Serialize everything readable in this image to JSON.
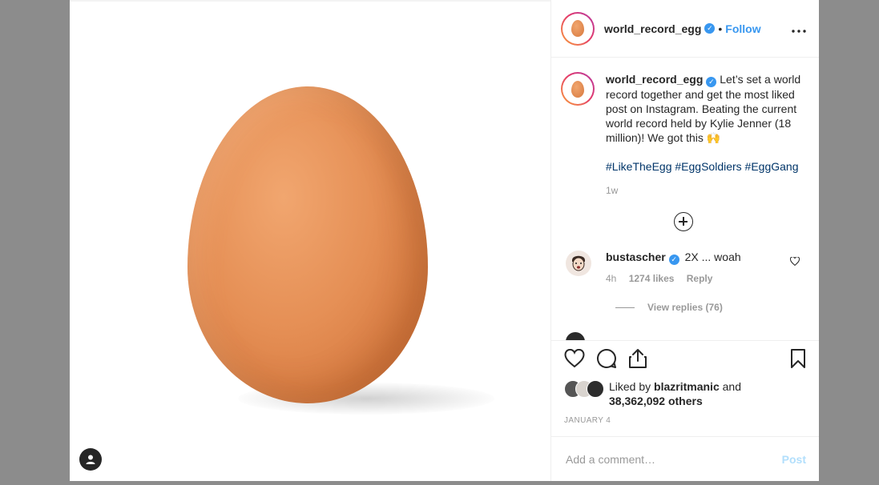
{
  "header": {
    "username": "world_record_egg",
    "separator": "•",
    "follow_label": "Follow",
    "more_icon": "more-horizontal-icon"
  },
  "caption": {
    "username": "world_record_egg",
    "text": "Let’s set a world record together and get the most liked post on Instagram. Beating the current world record held by Kylie Jenner (18 million)! We got this 🙌",
    "hashtags": "#LikeTheEgg #EggSoldiers #EggGang",
    "time": "1w"
  },
  "comments": [
    {
      "username": "bustascher",
      "text": "2X ... woah",
      "time": "4h",
      "likes": "1274 likes",
      "reply_label": "Reply",
      "view_replies": "View replies (76)"
    }
  ],
  "likes": {
    "prefix": "Liked by",
    "user": "blazritmanic",
    "and": "and",
    "count": "38,362,092 others"
  },
  "date": "JANUARY 4",
  "add_comment": {
    "placeholder": "Add a comment…",
    "post_label": "Post"
  },
  "colors": {
    "accent": "#3897f0",
    "hashtag": "#003569",
    "egg": "#e58f55"
  }
}
